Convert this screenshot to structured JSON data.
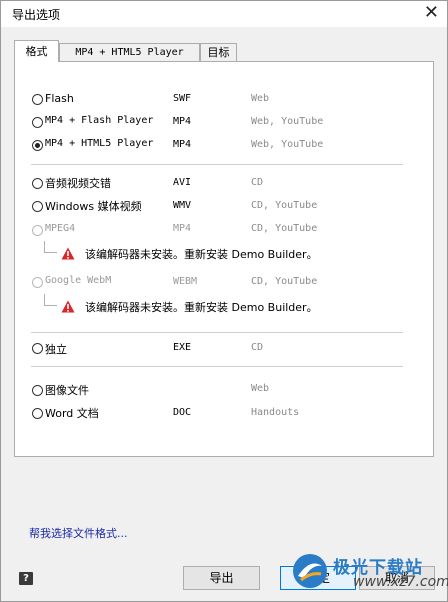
{
  "window": {
    "title": "导出选项",
    "close_glyph": "✕"
  },
  "tabs": [
    {
      "label": "格式",
      "active": true
    },
    {
      "label": "MP4 + HTML5 Player",
      "active": false
    },
    {
      "label": "目标",
      "active": false
    }
  ],
  "formats": [
    {
      "label": "Flash",
      "ext": "SWF",
      "target": "Web",
      "checked": false,
      "disabled": false
    },
    {
      "label": "MP4 + Flash Player",
      "ext": "MP4",
      "target": "Web, YouTube",
      "checked": false,
      "disabled": false
    },
    {
      "label": "MP4 + HTML5 Player",
      "ext": "MP4",
      "target": "Web, YouTube",
      "checked": true,
      "disabled": false
    },
    {
      "label": "音频视频交错",
      "ext": "AVI",
      "target": "CD",
      "checked": false,
      "disabled": false
    },
    {
      "label": "Windows 媒体视频",
      "ext": "WMV",
      "target": "CD, YouTube",
      "checked": false,
      "disabled": false
    },
    {
      "label": "MPEG4",
      "ext": "MP4",
      "target": "CD, YouTube",
      "checked": false,
      "disabled": true
    },
    {
      "label": "Google WebM",
      "ext": "WEBM",
      "target": "CD, YouTube",
      "checked": false,
      "disabled": true
    },
    {
      "label": "独立",
      "ext": "EXE",
      "target": "CD",
      "checked": false,
      "disabled": false
    },
    {
      "label": "图像文件",
      "ext": "",
      "target": "Web",
      "checked": false,
      "disabled": false
    },
    {
      "label": "Word 文档",
      "ext": "DOC",
      "target": "Handouts",
      "checked": false,
      "disabled": false
    }
  ],
  "warnings": {
    "mpeg4": "该编解码器未安装。重新安装 Demo Builder。",
    "webm": "该编解码器未安装。重新安装 Demo Builder。"
  },
  "help_link": "帮我选择文件格式...",
  "help_button": "?",
  "buttons": {
    "export": "导出",
    "ok": "确定",
    "cancel": "取消"
  },
  "watermark": {
    "name": "极光下载站",
    "url": "www.xz7.com"
  },
  "colors": {
    "link": "#1a2aa8",
    "warning": "#d9262c",
    "disabled": "#9a9a9a"
  }
}
